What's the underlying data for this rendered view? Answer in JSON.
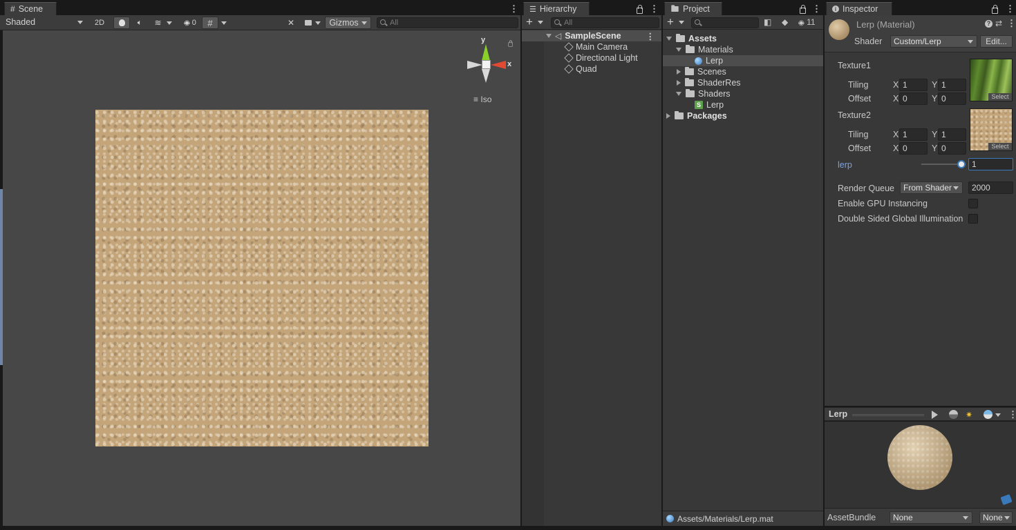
{
  "scene": {
    "tab_label": "Scene",
    "shading_mode": "Shaded",
    "btn_2d": "2D",
    "hidden_count": "0",
    "gizmos_label": "Gizmos",
    "search_placeholder": "All",
    "axis_y": "y",
    "axis_x": "x",
    "projection_label": "Iso"
  },
  "hierarchy": {
    "tab_label": "Hierarchy",
    "search_placeholder": "All",
    "scene_name": "SampleScene",
    "objects": [
      {
        "label": "Main Camera"
      },
      {
        "label": "Directional Light"
      },
      {
        "label": "Quad"
      }
    ]
  },
  "project": {
    "tab_label": "Project",
    "hidden_count": "11",
    "tree": {
      "assets": "Assets",
      "materials": "Materials",
      "material_lerp": "Lerp",
      "scenes": "Scenes",
      "shaderres": "ShaderRes",
      "shaders": "Shaders",
      "shader_lerp": "Lerp",
      "packages": "Packages"
    },
    "footer_path": "Assets/Materials/Lerp.mat"
  },
  "inspector": {
    "tab_label": "Inspector",
    "title": "Lerp (Material)",
    "shader_label": "Shader",
    "shader_value": "Custom/Lerp",
    "edit_button": "Edit...",
    "texture1": {
      "label": "Texture1",
      "tiling_label": "Tiling",
      "offset_label": "Offset",
      "tiling_x": "1",
      "tiling_y": "1",
      "offset_x": "0",
      "offset_y": "0",
      "select_label": "Select"
    },
    "texture2": {
      "label": "Texture2",
      "tiling_label": "Tiling",
      "offset_label": "Offset",
      "tiling_x": "1",
      "tiling_y": "1",
      "offset_x": "0",
      "offset_y": "0",
      "select_label": "Select"
    },
    "x_label": "X",
    "y_label": "Y",
    "lerp_label": "lerp",
    "lerp_value": "1",
    "lerp_slider_fraction": 1.0,
    "render_queue_label": "Render Queue",
    "render_queue_mode": "From Shader",
    "render_queue_value": "2000",
    "gpu_instancing_label": "Enable GPU Instancing",
    "double_sided_gi_label": "Double Sided Global Illumination",
    "preview_title": "Lerp",
    "assetbundle_label": "AssetBundle",
    "assetbundle_value": "None",
    "assetbundle_variant": "None"
  },
  "colors": {
    "accent_blue": "#3a79bb",
    "lerp_label_color": "#7ba2e0",
    "panel_bg": "#383838",
    "selected_row": "#4d4d4d"
  }
}
